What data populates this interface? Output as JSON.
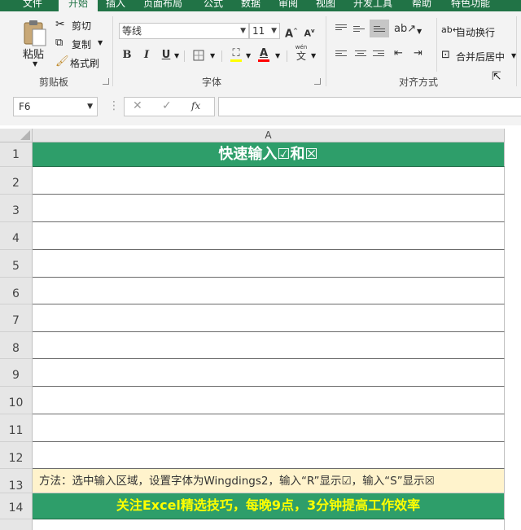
{
  "ribbon_tabs": [
    "文件",
    "开始",
    "插入",
    "页面布局",
    "公式",
    "数据",
    "审阅",
    "视图",
    "开发工具",
    "帮助",
    "特色功能"
  ],
  "clipboard": {
    "paste_label": "粘贴",
    "cut_label": "剪切",
    "copy_label": "复制",
    "format_painter_label": "格式刷",
    "group_label": "剪贴板"
  },
  "font": {
    "font_name": "等线",
    "font_size": "11",
    "bold": "B",
    "italic": "I",
    "underline": "U",
    "font_color_glyph": "A",
    "phonetic_label": "wén",
    "phonetic_glyph": "文",
    "grow_glyph": "A",
    "shrink_glyph": "A",
    "group_label": "字体"
  },
  "alignment": {
    "wrap_text_label": "自动换行",
    "merge_center_label": "合并后居中",
    "group_label": "对齐方式"
  },
  "formula_bar": {
    "name_box": "F6",
    "fx_label": "fx",
    "formula": ""
  },
  "sheet": {
    "column_header": "A",
    "rows": [
      "1",
      "2",
      "3",
      "4",
      "5",
      "6",
      "7",
      "8",
      "9",
      "10",
      "11",
      "12",
      "13",
      "14"
    ],
    "title": "快速输入☑和☒",
    "method_note": "方法：选中输入区域，设置字体为Wingdings2，输入“R”显示☑，输入“S”显示☒",
    "footer": "关注Excel精选技巧，每晚9点，3分钟提高工作效率"
  },
  "colors": {
    "excel_green": "#217346",
    "header_fill": "#2e9e6a",
    "note_fill": "#fff3cc",
    "footer_text": "#ffff00"
  }
}
